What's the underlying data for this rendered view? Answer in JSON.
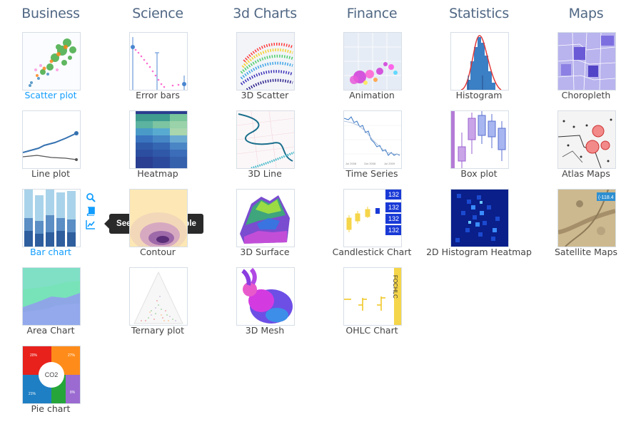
{
  "columns": [
    {
      "title": "Business",
      "items": [
        "Scatter plot",
        "Line plot",
        "Bar chart",
        "Area Chart",
        "Pie chart"
      ]
    },
    {
      "title": "Science",
      "items": [
        "Error bars",
        "Heatmap",
        "Contour",
        "Ternary plot"
      ]
    },
    {
      "title": "3d Charts",
      "items": [
        "3D Scatter",
        "3D Line",
        "3D Surface",
        "3D Mesh"
      ]
    },
    {
      "title": "Finance",
      "items": [
        "Animation",
        "Time Series",
        "Candlestick Chart",
        "OHLC Chart"
      ]
    },
    {
      "title": "Statistics",
      "items": [
        "Histogram",
        "Box plot",
        "2D Histogram Heatmap"
      ]
    },
    {
      "title": "Maps",
      "items": [
        "Choropleth",
        "Atlas Maps",
        "Satellite Maps"
      ]
    }
  ],
  "thumb_text": {
    "pie_center": "CO2",
    "pie_pct1": "20%",
    "pie_pct2": "27%",
    "pie_pct3": "21%",
    "pie_pct4": "8%",
    "candle_tag": "132",
    "atlas_tag": "(-118.4",
    "ohlc_tag": "FOCHLC",
    "ts_ticks": [
      "Jul 2008",
      "Oct 2008",
      "Jul 2009"
    ]
  },
  "side_icons": [
    "search-icon",
    "book-icon",
    "line-chart-icon"
  ],
  "tooltip": "See a basic example",
  "colors": {
    "heading": "#506784",
    "active_label": "#119dff",
    "label": "#444444",
    "tooltip_bg": "#2a2a2a"
  }
}
